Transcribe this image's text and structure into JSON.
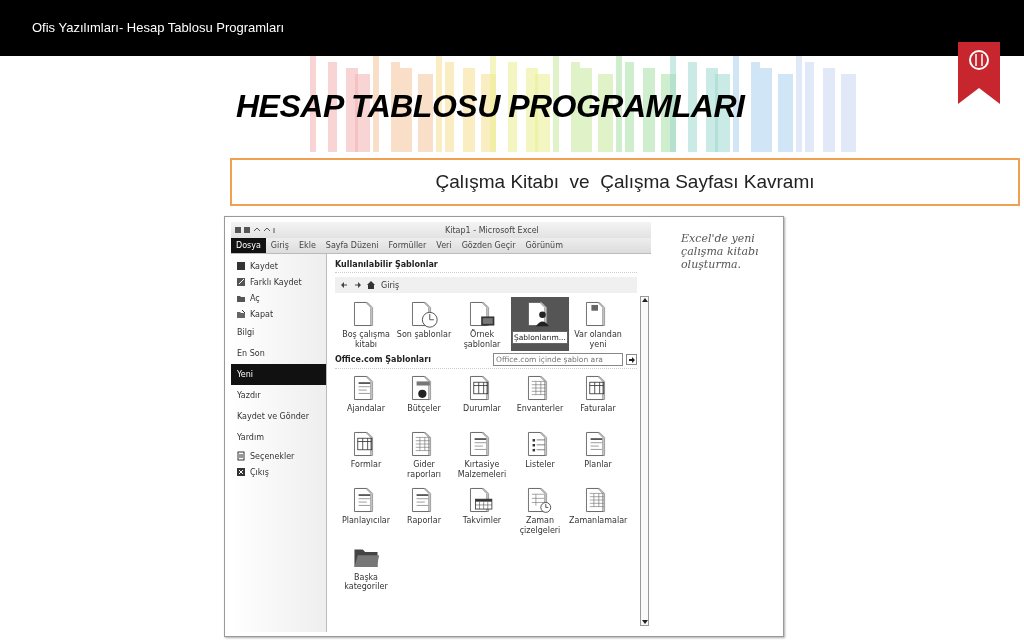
{
  "header": {
    "title": "Ofis Yazılımları- Hesap Tablosu Programları"
  },
  "slide": {
    "title": "HESAP TABLOSU PROGRAMLARI",
    "subtitle": "Çalışma Kitabı  ve  Çalışma Sayfası Kavramı",
    "caption": [
      "Excel'de yeni",
      "çalışma kitabı",
      "oluşturma."
    ]
  },
  "excel": {
    "window_title": "Kitap1 - Microsoft Excel",
    "tabs": [
      {
        "label": "Dosya",
        "selected": true
      },
      {
        "label": "Giriş",
        "selected": false
      },
      {
        "label": "Ekle",
        "selected": false
      },
      {
        "label": "Sayfa Düzeni",
        "selected": false
      },
      {
        "label": "Formüller",
        "selected": false
      },
      {
        "label": "Veri",
        "selected": false
      },
      {
        "label": "Gözden Geçir",
        "selected": false
      },
      {
        "label": "Görünüm",
        "selected": false
      }
    ],
    "backstage": [
      {
        "kind": "command",
        "label": "Kaydet"
      },
      {
        "kind": "command",
        "label": "Farklı Kaydet"
      },
      {
        "kind": "command",
        "label": "Aç"
      },
      {
        "kind": "command",
        "label": "Kapat"
      },
      {
        "kind": "section",
        "label": "Bilgi",
        "selected": false
      },
      {
        "kind": "section",
        "label": "En Son",
        "selected": false
      },
      {
        "kind": "section",
        "label": "Yeni",
        "selected": true
      },
      {
        "kind": "section",
        "label": "Yazdır",
        "selected": false
      },
      {
        "kind": "section",
        "label": "Kaydet ve Gönder",
        "selected": false
      },
      {
        "kind": "section",
        "label": "Yardım",
        "selected": false
      },
      {
        "kind": "command",
        "label": "Seçenekler"
      },
      {
        "kind": "command",
        "label": "Çıkış"
      }
    ],
    "heading": "Kullanılabilir Şablonlar",
    "breadcrumb": "Giriş",
    "available": [
      {
        "kind": "blank",
        "label": "Boş çalışma kitabı",
        "selected": false
      },
      {
        "kind": "recent",
        "label": "Son şablonlar",
        "selected": false
      },
      {
        "kind": "sample",
        "label": "Örnek şablonlar",
        "selected": false
      },
      {
        "kind": "mine",
        "tooltip": "Şablonlarım...",
        "selected": true
      },
      {
        "kind": "existing",
        "label": "Var olandan yeni",
        "selected": false
      }
    ],
    "office_heading": "Office.com Şablonları",
    "search": {
      "placeholder": "Office.com içinde şablon ara"
    },
    "office": [
      {
        "kind": "doc",
        "label": "Ajandalar"
      },
      {
        "kind": "chart",
        "label": "Bütçeler"
      },
      {
        "kind": "table",
        "label": "Durumlar"
      },
      {
        "kind": "grid",
        "label": "Envanterler"
      },
      {
        "kind": "table",
        "label": "Faturalar"
      },
      {
        "kind": "table",
        "label": "Formlar"
      },
      {
        "kind": "grid",
        "label": "Gider raporları"
      },
      {
        "kind": "doc",
        "label": "Kırtasiye Malzemeleri"
      },
      {
        "kind": "list",
        "label": "Listeler"
      },
      {
        "kind": "doc",
        "label": "Planlar"
      },
      {
        "kind": "doc",
        "label": "Planlayıcılar"
      },
      {
        "kind": "doc",
        "label": "Raporlar"
      },
      {
        "kind": "calendar",
        "label": "Takvimler"
      },
      {
        "kind": "clockgrid",
        "label": "Zaman çizelgeleri"
      },
      {
        "kind": "grid",
        "label": "Zamanlamalar"
      },
      {
        "kind": "folder",
        "label": "Başka kategoriler"
      }
    ]
  }
}
